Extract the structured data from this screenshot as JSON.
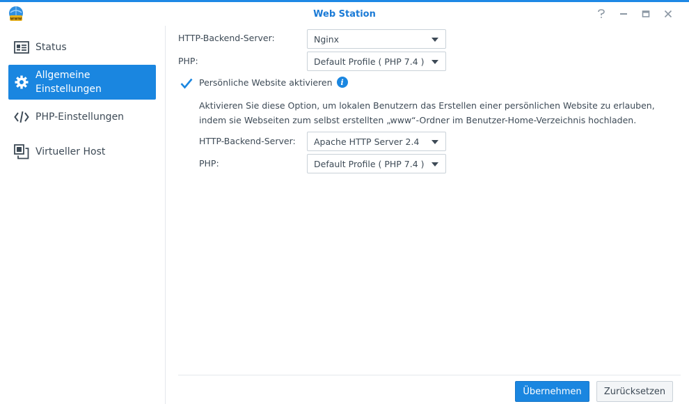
{
  "window": {
    "title": "Web Station",
    "controls": [
      "help-icon",
      "minimize-icon",
      "maximize-icon",
      "close-icon"
    ]
  },
  "sidebar": {
    "items": [
      {
        "label": "Status",
        "icon": "status-card-icon",
        "active": false
      },
      {
        "label": "Allgemeine Einstellungen",
        "icon": "gear-icon",
        "active": true
      },
      {
        "label": "PHP-Einstellungen",
        "icon": "code-icon",
        "active": false
      },
      {
        "label": "Virtueller Host",
        "icon": "virtual-host-icon",
        "active": false
      }
    ]
  },
  "main": {
    "backend_label": "HTTP-Backend-Server:",
    "backend_value": "Nginx",
    "php_label": "PHP:",
    "php_value": "Default Profile ( PHP 7.4 )",
    "personal_site": {
      "checkbox_label": "Persönliche Website aktivieren",
      "checked": true,
      "description": "Aktivieren Sie diese Option, um lokalen Benutzern das Erstellen einer persönlichen Website zu erlauben, indem sie Webseiten zum selbst erstellten „www“-Ordner im Benutzer-Home-Verzeichnis hochladen.",
      "backend_label": "HTTP-Backend-Server:",
      "backend_value": "Apache HTTP Server 2.4",
      "php_label": "PHP:",
      "php_value": "Default Profile ( PHP 7.4 )"
    }
  },
  "footer": {
    "apply_label": "Übernehmen",
    "reset_label": "Zurücksetzen"
  },
  "colors": {
    "accent": "#1a86e0",
    "title": "#1a7ad6",
    "text": "#3d4a56"
  }
}
